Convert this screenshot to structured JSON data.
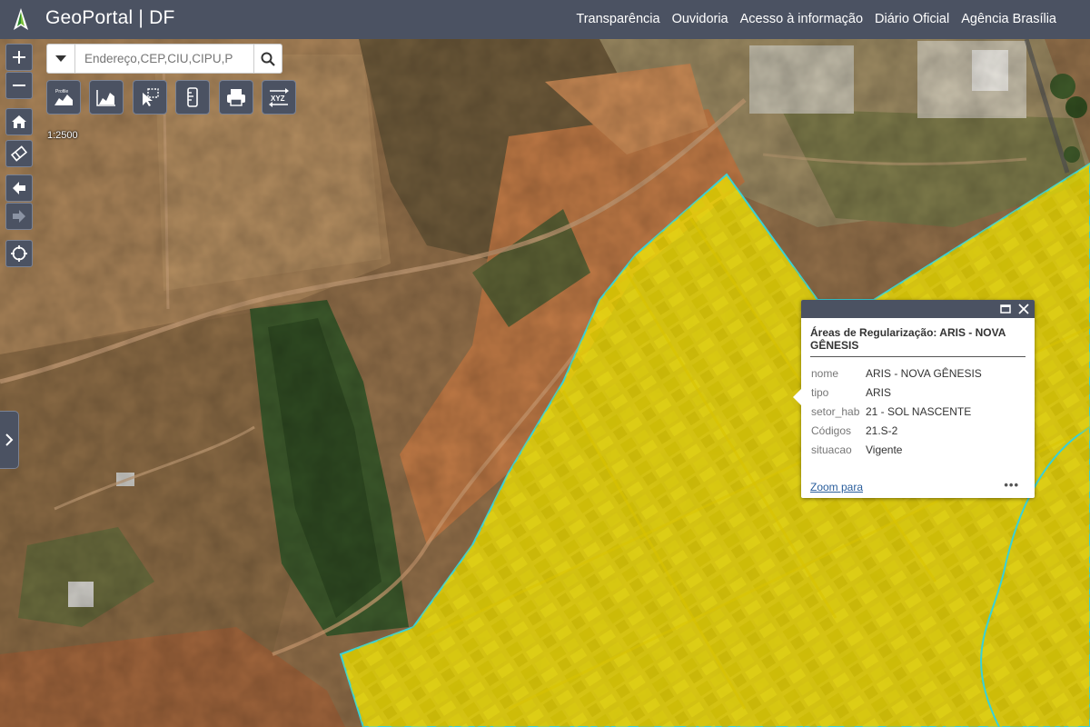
{
  "header": {
    "brand": "GeoPortal | DF",
    "nav": [
      "Transparência",
      "Ouvidoria",
      "Acesso à informação",
      "Diário Oficial",
      "Agência Brasília"
    ]
  },
  "search": {
    "placeholder": "Endereço,CEP,CIU,CIPU,P"
  },
  "widgets": [
    {
      "name": "profile-tool-button",
      "icon": "profile-icon"
    },
    {
      "name": "elevation-tool-button",
      "icon": "elevation-chart-icon"
    },
    {
      "name": "select-tool-button",
      "icon": "select-cursor-icon"
    },
    {
      "name": "measure-tool-button",
      "icon": "ruler-icon"
    },
    {
      "name": "print-button",
      "icon": "printer-icon"
    },
    {
      "name": "coordinates-xyz-button",
      "icon": "xyz-icon"
    }
  ],
  "widget_labels": {
    "xyz": "XYZ"
  },
  "scale": "1:2500",
  "popup": {
    "title": "Áreas de Regularização: ARIS - NOVA GÊNESIS",
    "attributes": [
      {
        "key": "nome",
        "value": "ARIS - NOVA GÊNESIS"
      },
      {
        "key": "tipo",
        "value": "ARIS"
      },
      {
        "key": "setor_hab",
        "value": "21 - SOL NASCENTE"
      },
      {
        "key": "Códigos",
        "value": "21.S-2"
      },
      {
        "key": "situacao",
        "value": "Vigente"
      }
    ],
    "zoom_label": "Zoom para",
    "more_label": "•••"
  },
  "colors": {
    "header": "#4b5262",
    "highlight_fill": "#f2e600",
    "highlight_border": "#39d1d6",
    "link": "#2a5e9c"
  }
}
